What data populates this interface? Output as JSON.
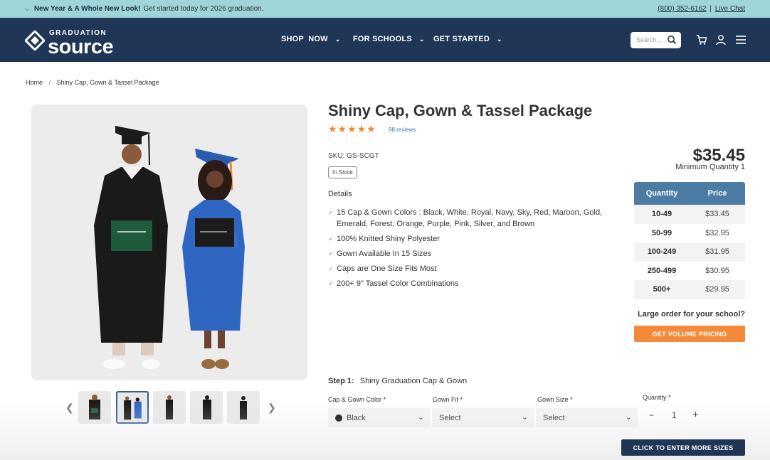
{
  "promo": {
    "headline": "New Year & A Whole New Look!",
    "text": "Get started today for 2026 graduation.",
    "phone": "(800) 352-6162",
    "divider": "|",
    "chat": "Live Chat"
  },
  "header": {
    "logo_small": "GRADUATION",
    "logo_big": "source",
    "nav": [
      {
        "label": "SHOP  NOW"
      },
      {
        "label": "FOR SCHOOLS"
      },
      {
        "label": "GET STARTED"
      }
    ],
    "search_placeholder": "Search..."
  },
  "breadcrumb": {
    "home": "Home",
    "sep": "/",
    "current": "Shiny Cap, Gown & Tassel Package"
  },
  "product": {
    "title": "Shiny Cap, Gown & Tassel Package",
    "rating": 5,
    "stars": "★★★★★",
    "reviews": "98 reviews",
    "sku": "SKU: GS-SCGT",
    "stock": "In Stock",
    "details_heading": "Details",
    "details": [
      "15 Cap & Gown Colors : Black, White, Royal, Navy, Sky, Red, Maroon, Gold, Emerald, Forest, Orange, Purple, Pink, Silver, and Brown",
      "100% Knitted Shiny Polyester",
      "Gown Available In 15 Sizes",
      "Caps are One Size Fits Most",
      "200+ 9\" Tassel Color Combinations"
    ],
    "price": "$35.45",
    "min_qty": "Minimum Quantity 1"
  },
  "pricing_table": {
    "headers": [
      "Quantity",
      "Price"
    ],
    "rows": [
      [
        "10-49",
        "$33.45"
      ],
      [
        "50-99",
        "$32.95"
      ],
      [
        "100-249",
        "$31.95"
      ],
      [
        "250-499",
        "$30.95"
      ],
      [
        "500+",
        "$29.95"
      ]
    ]
  },
  "volume": {
    "prompt": "Large order for your school?",
    "button": "GET VOLUME PRICING"
  },
  "step": {
    "label": "Step 1:",
    "name": "Shiny Graduation Cap & Gown"
  },
  "fields": {
    "color_label": "Cap & Gown Color *",
    "color_value": "Black",
    "fit_label": "Gown Fit *",
    "fit_value": "Select",
    "size_label": "Gown Size *",
    "size_value": "Select",
    "qty_label": "Quantity *",
    "qty_minus": "−",
    "qty_value": "1",
    "qty_plus": "+"
  },
  "enter_sizes_button": "CLICK TO ENTER MORE SIZES",
  "colors": {
    "navy": "#1f3657",
    "teal_banner": "#9fd5d9",
    "orange": "#f5893a",
    "table_header": "#4c7ca6"
  }
}
